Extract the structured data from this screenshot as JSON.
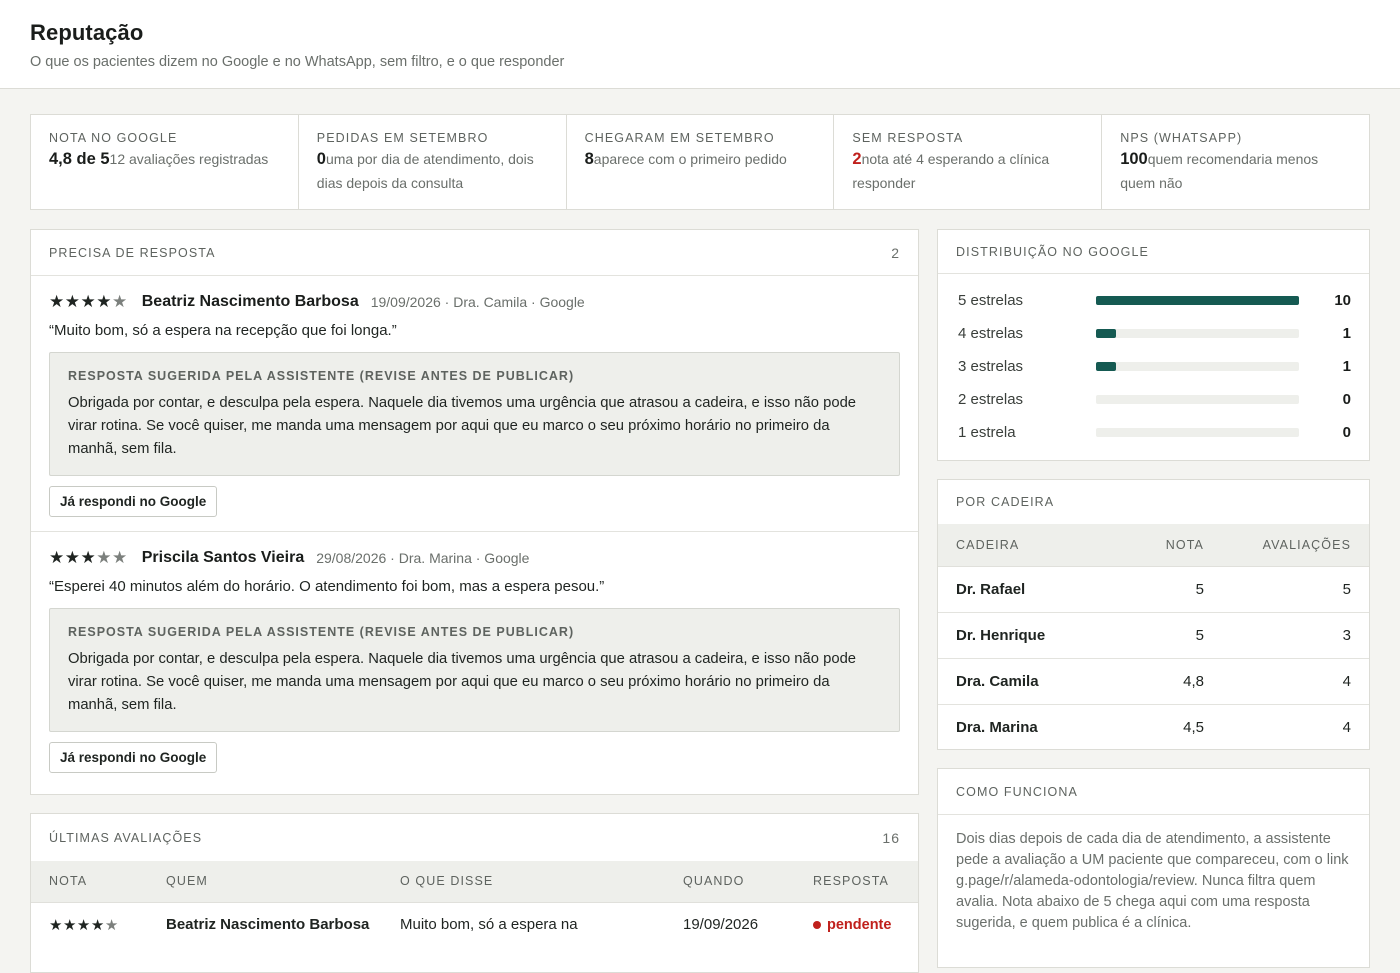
{
  "header": {
    "title": "Reputação",
    "subtitle": "O que os pacientes dizem no Google e no WhatsApp, sem filtro, e o que responder"
  },
  "kpis": [
    {
      "label": "NOTA NO GOOGLE",
      "value": "4,8 de 5",
      "text": "12 avaliações registradas"
    },
    {
      "label": "PEDIDAS EM SETEMBRO",
      "value": "0",
      "text": "uma por dia de atendimento, dois dias depois da consulta"
    },
    {
      "label": "CHEGARAM EM SETEMBRO",
      "value": "8",
      "text": "aparece com o primeiro pedido"
    },
    {
      "label": "SEM RESPOSTA",
      "value": "2",
      "text": "nota até 4 esperando a clínica responder"
    },
    {
      "label": "NPS (WHATSAPP)",
      "value": "100",
      "text": "quem recomendaria menos quem não"
    }
  ],
  "pending": {
    "title": "PRECISA DE RESPOSTA",
    "count": "2",
    "reviews": [
      {
        "rating": 4,
        "name": "Beatriz Nascimento Barbosa",
        "meta": "19/09/2026 · Dra. Camila · Google",
        "quote": "“Muito bom, só a espera na recepção que foi longa.”",
        "suggest_label": "RESPOSTA SUGERIDA PELA ASSISTENTE (REVISE ANTES DE PUBLICAR)",
        "suggest_text": "Obrigada por contar, e desculpa pela espera. Naquele dia tivemos uma urgência que atrasou a cadeira, e isso não pode virar rotina. Se você quiser, me manda uma mensagem por aqui que eu marco o seu próximo horário no primeiro da manhã, sem fila.",
        "button": "Já respondi no Google"
      },
      {
        "rating": 3,
        "name": "Priscila Santos Vieira",
        "meta": "29/08/2026 · Dra. Marina · Google",
        "quote": "“Esperei 40 minutos além do horário. O atendimento foi bom, mas a espera pesou.”",
        "suggest_label": "RESPOSTA SUGERIDA PELA ASSISTENTE (REVISE ANTES DE PUBLICAR)",
        "suggest_text": "Obrigada por contar, e desculpa pela espera. Naquele dia tivemos uma urgência que atrasou a cadeira, e isso não pode virar rotina. Se você quiser, me manda uma mensagem por aqui que eu marco o seu próximo horário no primeiro da manhã, sem fila.",
        "button": "Já respondi no Google"
      }
    ]
  },
  "distribution": {
    "title": "DISTRIBUIÇÃO NO GOOGLE",
    "max": 10,
    "rows": [
      {
        "label": "5 estrelas",
        "count": 10
      },
      {
        "label": "4 estrelas",
        "count": 1
      },
      {
        "label": "3 estrelas",
        "count": 1
      },
      {
        "label": "2 estrelas",
        "count": 0
      },
      {
        "label": "1 estrela",
        "count": 0
      }
    ]
  },
  "chairs": {
    "title": "POR CADEIRA",
    "columns": [
      "CADEIRA",
      "NOTA",
      "AVALIAÇÕES"
    ],
    "rows": [
      {
        "name": "Dr. Rafael",
        "nota": "5",
        "count": "5"
      },
      {
        "name": "Dr. Henrique",
        "nota": "5",
        "count": "3"
      },
      {
        "name": "Dra. Camila",
        "nota": "4,8",
        "count": "4"
      },
      {
        "name": "Dra. Marina",
        "nota": "4,5",
        "count": "4"
      }
    ]
  },
  "how": {
    "title": "COMO FUNCIONA",
    "text": "Dois dias depois de cada dia de atendimento, a assistente pede a avaliação a UM paciente que compareceu, com o link g.page/r/alameda-odontologia/review. Nunca filtra quem avalia. Nota abaixo de 5 chega aqui com uma resposta sugerida, e quem publica é a clínica."
  },
  "latest": {
    "title": "ÚLTIMAS AVALIAÇÕES",
    "count": "16",
    "columns": [
      "NOTA",
      "QUEM",
      "O QUE DISSE",
      "QUANDO",
      "RESPOSTA"
    ],
    "rows": [
      {
        "rating": 4,
        "who": "Beatriz Nascimento Barbosa",
        "said": "Muito bom, só a espera na",
        "when": "19/09/2026",
        "status": "pendente"
      }
    ]
  },
  "colors": {
    "accent": "#155a52",
    "alert": "#c0201c"
  }
}
